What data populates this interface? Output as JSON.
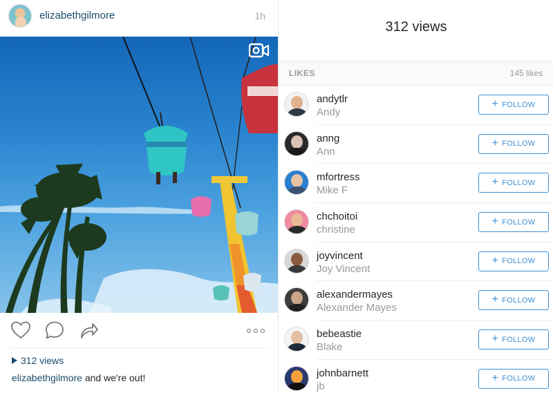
{
  "post": {
    "username": "elizabethgilmore",
    "time": "1h",
    "views_label": "312 views",
    "caption_user": "elizabethgilmore",
    "caption_text": " and we're out!",
    "icons": {
      "video": "video-camera-icon",
      "like": "heart-icon",
      "comment": "comment-bubble-icon",
      "share": "share-arrow-icon",
      "more": "more-dots-icon",
      "play": "play-triangle-icon"
    }
  },
  "likes_panel": {
    "title": "312 views",
    "likes_label": "LIKES",
    "likes_count": "145 likes",
    "follow_label": "FOLLOW",
    "users": [
      {
        "username": "andytlr",
        "full_name": "Andy",
        "bg": "#f2f2f2",
        "skin": "#e1b28e",
        "shirt": "#2e3a48"
      },
      {
        "username": "anng",
        "full_name": "Ann",
        "bg": "#2a2a2a",
        "skin": "#d9c1b4",
        "shirt": "#1a1a1a"
      },
      {
        "username": "mfortress",
        "full_name": "Mike F",
        "bg": "#2a7fd1",
        "skin": "#e6c2a2",
        "shirt": "#3b4f6e"
      },
      {
        "username": "chchoitoi",
        "full_name": "christine",
        "bg": "#f08aa0",
        "skin": "#e9b996",
        "shirt": "#2b2b2b"
      },
      {
        "username": "joyvincent",
        "full_name": "Joy Vincent",
        "bg": "#d8d8d8",
        "skin": "#8a5b3c",
        "shirt": "#3a3a3a"
      },
      {
        "username": "alexandermayes",
        "full_name": "Alexander Mayes",
        "bg": "#3c3c3c",
        "skin": "#caa58a",
        "shirt": "#1f1f1f"
      },
      {
        "username": "bebeastie",
        "full_name": "Blake",
        "bg": "#f4f4f4",
        "skin": "#e3bea0",
        "shirt": "#1f2a38"
      },
      {
        "username": "johnbarnett",
        "full_name": "jb",
        "bg": "#2b3a6e",
        "skin": "#f2a23a",
        "shirt": "#111111"
      }
    ]
  },
  "colors": {
    "link_blue": "#1b4b6b",
    "follow_blue": "#3f8fd2",
    "muted_gray": "#999999"
  }
}
